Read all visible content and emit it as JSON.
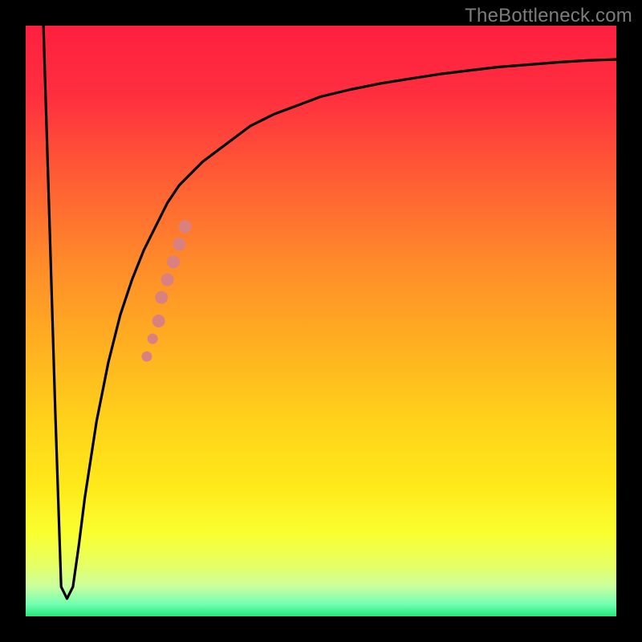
{
  "watermark": "TheBottleneck.com",
  "colors": {
    "frame": "#000000",
    "curve_stroke": "#000000",
    "marker_fill": "#d98080",
    "gradient_top": "#ff1f3f",
    "gradient_bottom": "#22e87a"
  },
  "chart_data": {
    "type": "line",
    "title": "",
    "xlabel": "",
    "ylabel": "",
    "xlim": [
      0,
      100
    ],
    "ylim": [
      0,
      100
    ],
    "x": [
      3,
      4,
      5,
      6,
      7,
      8,
      9,
      10,
      12,
      14,
      16,
      18,
      20,
      22,
      24,
      26,
      28,
      30,
      34,
      38,
      42,
      46,
      50,
      55,
      60,
      65,
      70,
      75,
      80,
      85,
      90,
      95,
      100
    ],
    "values": [
      100,
      68,
      35,
      5,
      3,
      5,
      12,
      20,
      33,
      43,
      51,
      57,
      62,
      66,
      70,
      73,
      75,
      77,
      80,
      83,
      85,
      86.5,
      88,
      89.2,
      90.2,
      91,
      91.8,
      92.4,
      93,
      93.4,
      93.8,
      94.1,
      94.3
    ],
    "markers": {
      "x": [
        20.5,
        21.5,
        22.5,
        23.0,
        24.0,
        25.0,
        26.0,
        27.0
      ],
      "y": [
        44,
        47,
        50,
        54,
        57,
        60,
        63,
        66
      ]
    }
  }
}
